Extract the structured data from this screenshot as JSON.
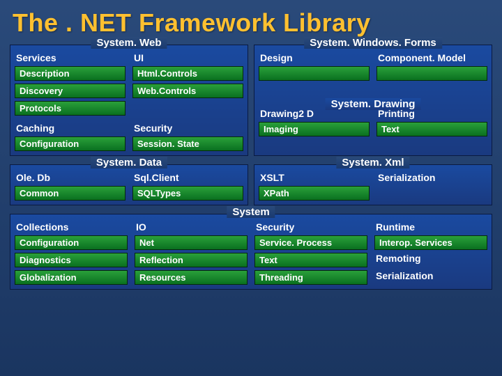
{
  "title": "The . NET Framework Library",
  "quadrants": {
    "system_web": {
      "header": "System. Web",
      "col1_head": "Services",
      "col2_head": "UI",
      "col1": [
        "Description",
        "Discovery",
        "Protocols"
      ],
      "col2": [
        "Html.Controls",
        "Web.Controls"
      ],
      "row2_col1": [
        "Caching",
        "Configuration"
      ],
      "row2_col2": [
        "Security",
        "Session. State"
      ]
    },
    "system_winforms": {
      "header": "System. Windows. Forms",
      "col1_head": "Design",
      "col2_head": "Component. Model"
    },
    "system_drawing": {
      "header": "System. Drawing",
      "col1": [
        "Drawing2 D",
        "Imaging"
      ],
      "col2": [
        "Printing",
        "Text"
      ]
    },
    "system_data": {
      "header": "System. Data",
      "col1": [
        "Ole. Db",
        "Common"
      ],
      "col2": [
        "Sql.Client",
        "SQLTypes"
      ]
    },
    "system_xml": {
      "header": "System. Xml",
      "col1": [
        "XSLT",
        "XPath"
      ],
      "col2": [
        "Serialization"
      ]
    }
  },
  "system": {
    "header": "System",
    "col1": [
      "Collections",
      "Configuration",
      "Diagnostics",
      "Globalization"
    ],
    "col2": [
      "IO",
      "Net",
      "Reflection",
      "Resources"
    ],
    "col3": [
      "Security",
      "Service. Process",
      "Text",
      "Threading"
    ],
    "col4_head": "Runtime",
    "col4": [
      "Interop. Services",
      "Remoting",
      "Serialization"
    ]
  }
}
